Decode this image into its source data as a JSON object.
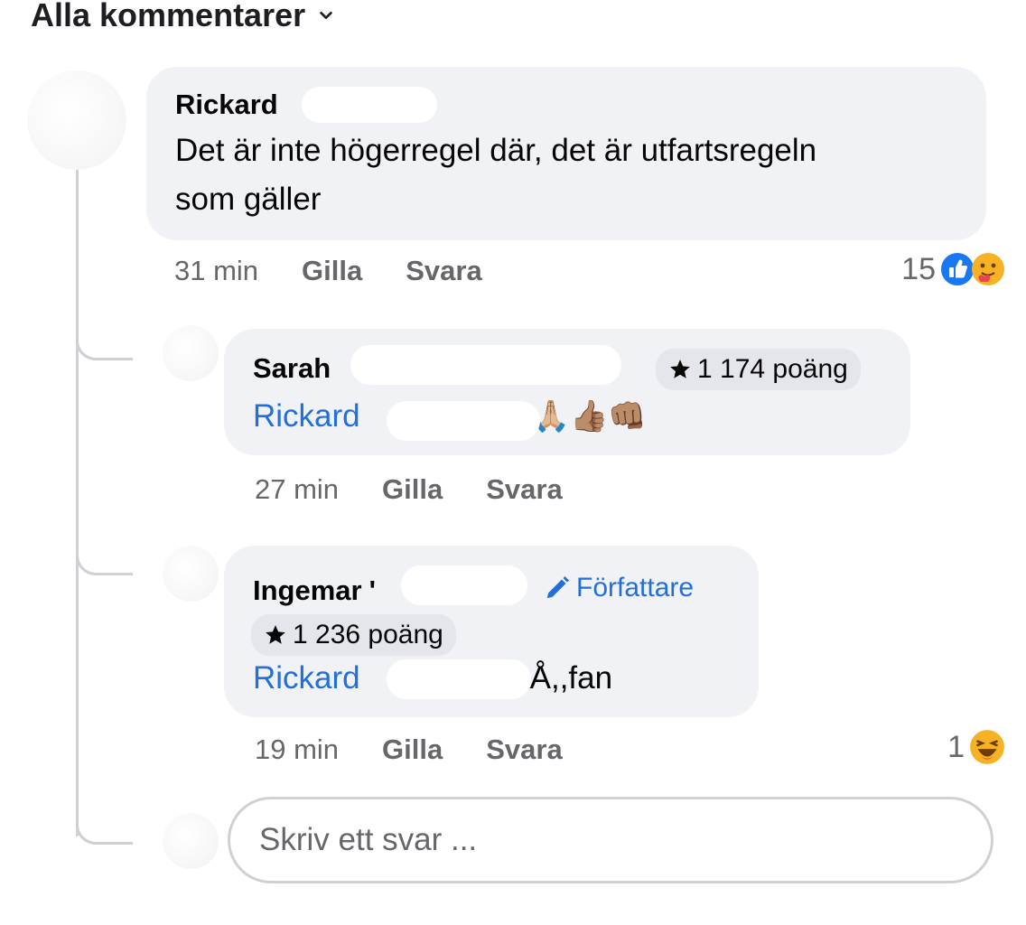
{
  "filter": {
    "label": "Alla kommentarer"
  },
  "comments": [
    {
      "name": "Rickard",
      "text_line1": "Det är inte högerregel där, det är utfartsregeln",
      "text_line2": "som gäller",
      "time": "31 min",
      "like": "Gilla",
      "reply": "Svara",
      "reaction_count": "15",
      "reaction_icons": [
        "like-icon",
        "care-icon"
      ]
    },
    {
      "name": "Sarah",
      "points": "1 174 poäng",
      "mention": "Rickard",
      "emojis": "🙏🏼👍🏽👊🏽",
      "time": "27 min",
      "like": "Gilla",
      "reply": "Svara"
    },
    {
      "name": "Ingemar",
      "name_suffix": "'",
      "author_label": "Författare",
      "points": "1 236 poäng",
      "mention": "Rickard",
      "text": "Å,,fan",
      "time": "19 min",
      "like": "Gilla",
      "reply": "Svara",
      "reaction_count": "1",
      "reaction_icons": [
        "haha-icon"
      ]
    }
  ],
  "reply_input": {
    "placeholder": "Skriv ett svar ..."
  },
  "colors": {
    "bubble": "#f0f2f5",
    "mention": "#216fdb",
    "meta": "#65676b",
    "like_blue": "#1877f2",
    "thread_line": "#ced0d4"
  }
}
